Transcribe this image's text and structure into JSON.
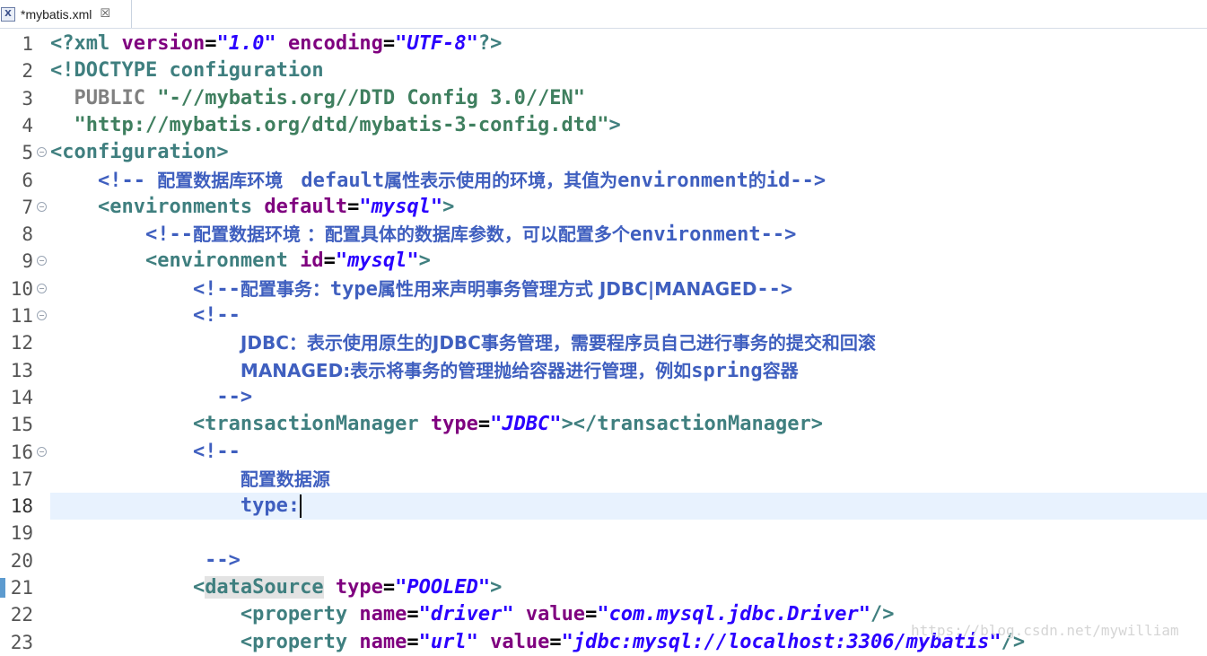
{
  "tab": {
    "icon": "xml-file-icon",
    "icon_glyph": "X",
    "label": "*mybatis.xml",
    "close_glyph": "☒"
  },
  "lines": [
    {
      "n": "1",
      "parts": [
        [
          "pi",
          "<?xml "
        ],
        [
          "attr",
          "version"
        ],
        [
          "eq",
          "="
        ],
        [
          "val",
          "\"1.0\""
        ],
        [
          "eq",
          " "
        ],
        [
          "attr",
          "encoding"
        ],
        [
          "eq",
          "="
        ],
        [
          "val",
          "\"UTF-8\""
        ],
        [
          "pi",
          "?>"
        ]
      ]
    },
    {
      "n": "2",
      "parts": [
        [
          "pi",
          "<!DOCTYPE configuration"
        ]
      ]
    },
    {
      "n": "3",
      "parts": [
        [
          "doc",
          "  PUBLIC "
        ],
        [
          "docstr",
          "\"-//mybatis.org//DTD Config 3.0//EN\""
        ]
      ]
    },
    {
      "n": "4",
      "parts": [
        [
          "docstr",
          "  \"http://mybatis.org/dtd/mybatis-3-config.dtd\""
        ],
        [
          "pi",
          ">"
        ]
      ]
    },
    {
      "n": "5",
      "fold": true,
      "parts": [
        [
          "tag",
          "<configuration>"
        ]
      ]
    },
    {
      "n": "6",
      "parts": [
        [
          "cm",
          "    <!-- "
        ],
        [
          "cmt",
          "配置数据库环境 "
        ],
        [
          "cm",
          " default"
        ],
        [
          "cmt",
          "属性表示使用的环境，其值为"
        ],
        [
          "cm",
          "environment"
        ],
        [
          "cmt",
          "的"
        ],
        [
          "cm",
          "id-->"
        ]
      ]
    },
    {
      "n": "7",
      "fold": true,
      "parts": [
        [
          "tag",
          "    <environments "
        ],
        [
          "attr",
          "default"
        ],
        [
          "eq",
          "="
        ],
        [
          "val",
          "\"mysql\""
        ],
        [
          "tag",
          ">"
        ]
      ]
    },
    {
      "n": "8",
      "parts": [
        [
          "cm",
          "        <!--"
        ],
        [
          "cmt",
          "配置数据环境 ：配置具体的数据库参数，可以配置多个"
        ],
        [
          "cm",
          "environment-->"
        ]
      ]
    },
    {
      "n": "9",
      "fold": true,
      "parts": [
        [
          "tag",
          "        <environment "
        ],
        [
          "attr",
          "id"
        ],
        [
          "eq",
          "="
        ],
        [
          "val",
          "\"mysql\""
        ],
        [
          "tag",
          ">"
        ]
      ]
    },
    {
      "n": "10",
      "fold": true,
      "parts": [
        [
          "cm",
          "            <!--"
        ],
        [
          "cmt",
          "配置事务："
        ],
        [
          "cm",
          "type"
        ],
        [
          "cmt",
          "属性用来声明事务管理方式 JDBC|MANAGED"
        ],
        [
          "cm",
          "-->"
        ]
      ]
    },
    {
      "n": "11",
      "fold": true,
      "parts": [
        [
          "cm",
          "            <!--"
        ]
      ]
    },
    {
      "n": "12",
      "parts": [
        [
          "cm",
          "                "
        ],
        [
          "cmt",
          "JDBC：表示使用原生的JDBC事务管理，需要程序员自己进行事务的提交和回滚"
        ]
      ]
    },
    {
      "n": "13",
      "parts": [
        [
          "cm",
          "                "
        ],
        [
          "cmt",
          "MANAGED:表示将事务的管理抛给容器进行管理，例如"
        ],
        [
          "cm",
          "spring"
        ],
        [
          "cmt",
          "容器"
        ]
      ]
    },
    {
      "n": "14",
      "parts": [
        [
          "cm",
          "              -->"
        ]
      ]
    },
    {
      "n": "15",
      "parts": [
        [
          "tag",
          "            <transactionManager "
        ],
        [
          "attr",
          "type"
        ],
        [
          "eq",
          "="
        ],
        [
          "val",
          "\"JDBC\""
        ],
        [
          "tag",
          "></transactionManager>"
        ]
      ]
    },
    {
      "n": "16",
      "fold": true,
      "parts": [
        [
          "cm",
          "            <!--"
        ]
      ]
    },
    {
      "n": "17",
      "parts": [
        [
          "cm",
          "                "
        ],
        [
          "cmt",
          "配置数据源"
        ]
      ]
    },
    {
      "n": "18",
      "current": true,
      "caret": true,
      "parts": [
        [
          "cm",
          "                type:"
        ]
      ]
    },
    {
      "n": "19",
      "parts": []
    },
    {
      "n": "20",
      "parts": [
        [
          "cm",
          "             -->"
        ]
      ]
    },
    {
      "n": "21",
      "marker": true,
      "parts": [
        [
          "tag",
          "            <"
        ],
        [
          "hl",
          "dataSource"
        ],
        [
          "tag",
          " "
        ],
        [
          "attr",
          "type"
        ],
        [
          "eq",
          "="
        ],
        [
          "val",
          "\"POOLED\""
        ],
        [
          "tag",
          ">"
        ]
      ]
    },
    {
      "n": "22",
      "parts": [
        [
          "tag",
          "                <property "
        ],
        [
          "attr",
          "name"
        ],
        [
          "eq",
          "="
        ],
        [
          "val",
          "\"driver\""
        ],
        [
          "eq",
          " "
        ],
        [
          "attr",
          "value"
        ],
        [
          "eq",
          "="
        ],
        [
          "val",
          "\"com.mysql.jdbc.Driver\""
        ],
        [
          "tag",
          "/>"
        ]
      ]
    },
    {
      "n": "23",
      "parts": [
        [
          "tag",
          "                <property "
        ],
        [
          "attr",
          "name"
        ],
        [
          "eq",
          "="
        ],
        [
          "val",
          "\"url\""
        ],
        [
          "eq",
          " "
        ],
        [
          "attr",
          "value"
        ],
        [
          "eq",
          "="
        ],
        [
          "val",
          "\"jdbc:mysql://localhost:3306/mybatis\""
        ],
        [
          "tag",
          "/>"
        ]
      ]
    }
  ],
  "watermark": "https://blog.csdn.net/mywilliam",
  "colors": {
    "tag": "#3f7f7f",
    "attr": "#7f007f",
    "value": "#2a00ff",
    "comment": "#3f5fbf",
    "current_line": "#e8f2fe"
  }
}
